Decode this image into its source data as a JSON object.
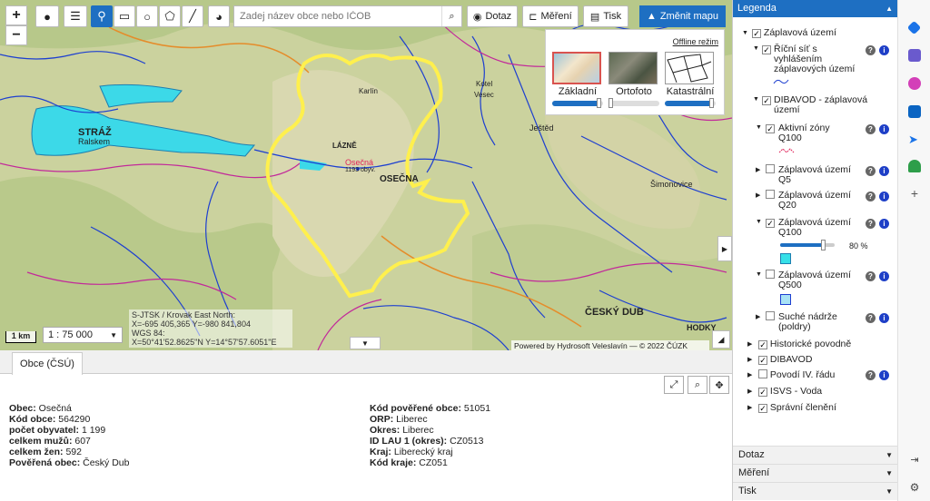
{
  "toolbar": {
    "search_placeholder": "Zadej název obce nebo IČOB",
    "dotaz_label": "Dotaz",
    "mereni_label": "Měření",
    "tisk_label": "Tisk",
    "zmenit_label": "Změnit mapu"
  },
  "basemap": {
    "offline_label": "Offline režim",
    "items": [
      {
        "label": "Základní",
        "opacity": 1.0,
        "selected": true
      },
      {
        "label": "Ortofoto",
        "opacity": 0.1
      },
      {
        "label": "Katastrální",
        "opacity": 1.0
      }
    ]
  },
  "map": {
    "crs_line1": "S-JTSK / Krovak East North:",
    "crs_line2": "X=-695 405,365 Y=-980 841,804",
    "crs_line3": "WGS 84:",
    "crs_line4": "X=50°41'52.8625\"N Y=14°57'57.6051\"E",
    "scale_bar": "1 km",
    "scale_value": "1 : 75 000",
    "attribution": "Powered by Hydrosoft Veleslavín — © 2022 ČÚZK",
    "labels": {
      "straz": "STRÁŽ",
      "ralskem": "Ralskem",
      "osecna": "OSEČNA",
      "osecna_point": "Osečná",
      "osecna_pop": "1193 obyv.",
      "cesky_dub": "ČESKÝ DUB",
      "simonovice": "Šimonovice",
      "karlin": "Karlín",
      "hodky": "HODKY",
      "jested": "Ještěd",
      "vesec": "Vesec",
      "januv_dul": "Janův Důl",
      "lazne": "LÁZNĚ",
      "kotel": "Kotel"
    }
  },
  "panel": {
    "tab_label": "Obce (ČSÚ)",
    "left": [
      {
        "key": "Obec:",
        "value": "Osečná"
      },
      {
        "key": "Kód obce:",
        "value": "564290"
      },
      {
        "key": "počet obyvatel:",
        "value": "1 199"
      },
      {
        "key": "celkem mužů:",
        "value": "607"
      },
      {
        "key": "celkem žen:",
        "value": "592"
      },
      {
        "key": "Pověřená obec:",
        "value": "Český Dub"
      }
    ],
    "right": [
      {
        "key": "Kód pověřené obce:",
        "value": "51051"
      },
      {
        "key": "ORP:",
        "value": "Liberec"
      },
      {
        "key": "Okres:",
        "value": "Liberec"
      },
      {
        "key": "ID LAU 1 (okres):",
        "value": "CZ0513"
      },
      {
        "key": "Kraj:",
        "value": "Liberecký kraj"
      },
      {
        "key": "Kód kraje:",
        "value": "CZ051"
      }
    ]
  },
  "legend": {
    "title": "Legenda",
    "zaplavova": "Záplavová území",
    "ricni_1": "Říční síť s",
    "ricni_2": "vyhlášením",
    "ricni_3": "záplavových území",
    "dibavod_zu_1": "DIBAVOD - záplavová",
    "dibavod_zu_2": "území",
    "aktivni_1": "Aktivní zóny",
    "aktivni_2": "Q100",
    "q5_1": "Záplavová území",
    "q5_2": "Q5",
    "q20_1": "Záplavová území",
    "q20_2": "Q20",
    "q100_1": "Záplavová území",
    "q100_2": "Q100",
    "q100_opacity": "80 %",
    "q100_opacity_value": 0.8,
    "q500_1": "Záplavová území",
    "q500_2": "Q500",
    "suche_1": "Suché nádrže",
    "suche_2": "(poldry)",
    "historicke": "Historické povodně",
    "dibavod": "DIBAVOD",
    "povodi": "Povodí IV. řádu",
    "isvs": "ISVS - Voda",
    "spravni": "Správní členění",
    "acc_dotaz": "Dotaz",
    "acc_mereni": "Měření",
    "acc_tisk": "Tisk"
  },
  "colors": {
    "accent": "#1e6fc2",
    "boundary": "#ffee55",
    "flood_q100": "#36e0e8",
    "flood_q500": "#a8e2f5"
  }
}
